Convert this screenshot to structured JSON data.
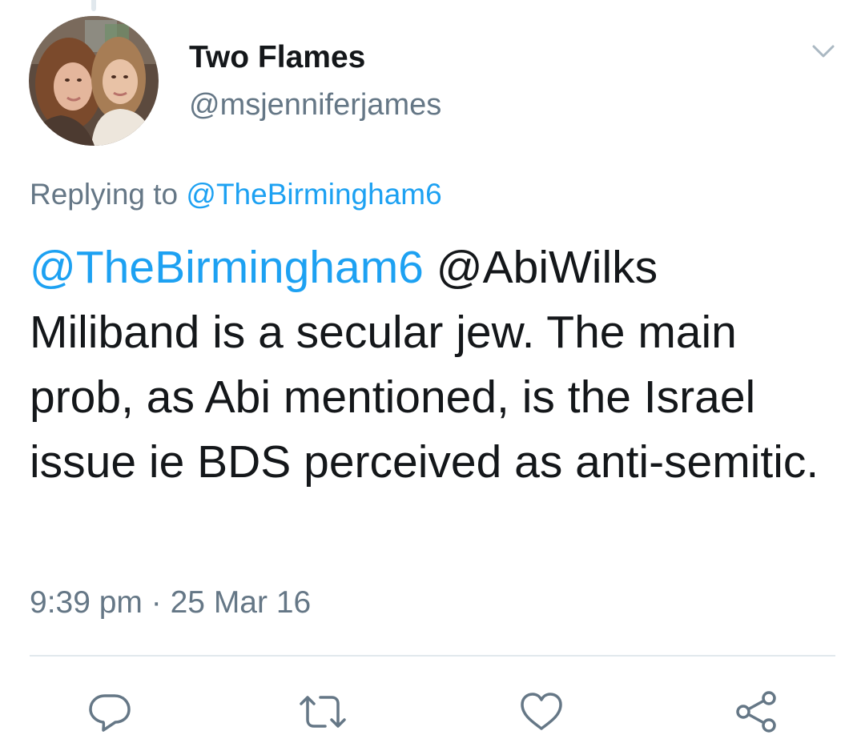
{
  "tweet": {
    "display_name": "Two Flames",
    "handle": "@msjenniferjames",
    "replying_prefix": "Replying to",
    "replying_to": "@TheBirmingham6",
    "mention_1": "@TheBirmingham6",
    "mention_2": "@AbiWilks",
    "body": "Miliband is a secular jew.  The main prob, as Abi mentioned, is the Israel issue ie BDS perceived as anti-semitic.",
    "time": "9:39 pm",
    "separator": "·",
    "date": "25 Mar 16"
  },
  "icons": {
    "caret": "chevron-down-icon",
    "reply": "reply-icon",
    "retweet": "retweet-icon",
    "like": "heart-icon",
    "share": "share-icon"
  },
  "colors": {
    "link": "#1da1f2",
    "secondary_text": "#657786",
    "primary_text": "#14171a",
    "icon": "#657786",
    "divider": "#e1e8ed"
  }
}
